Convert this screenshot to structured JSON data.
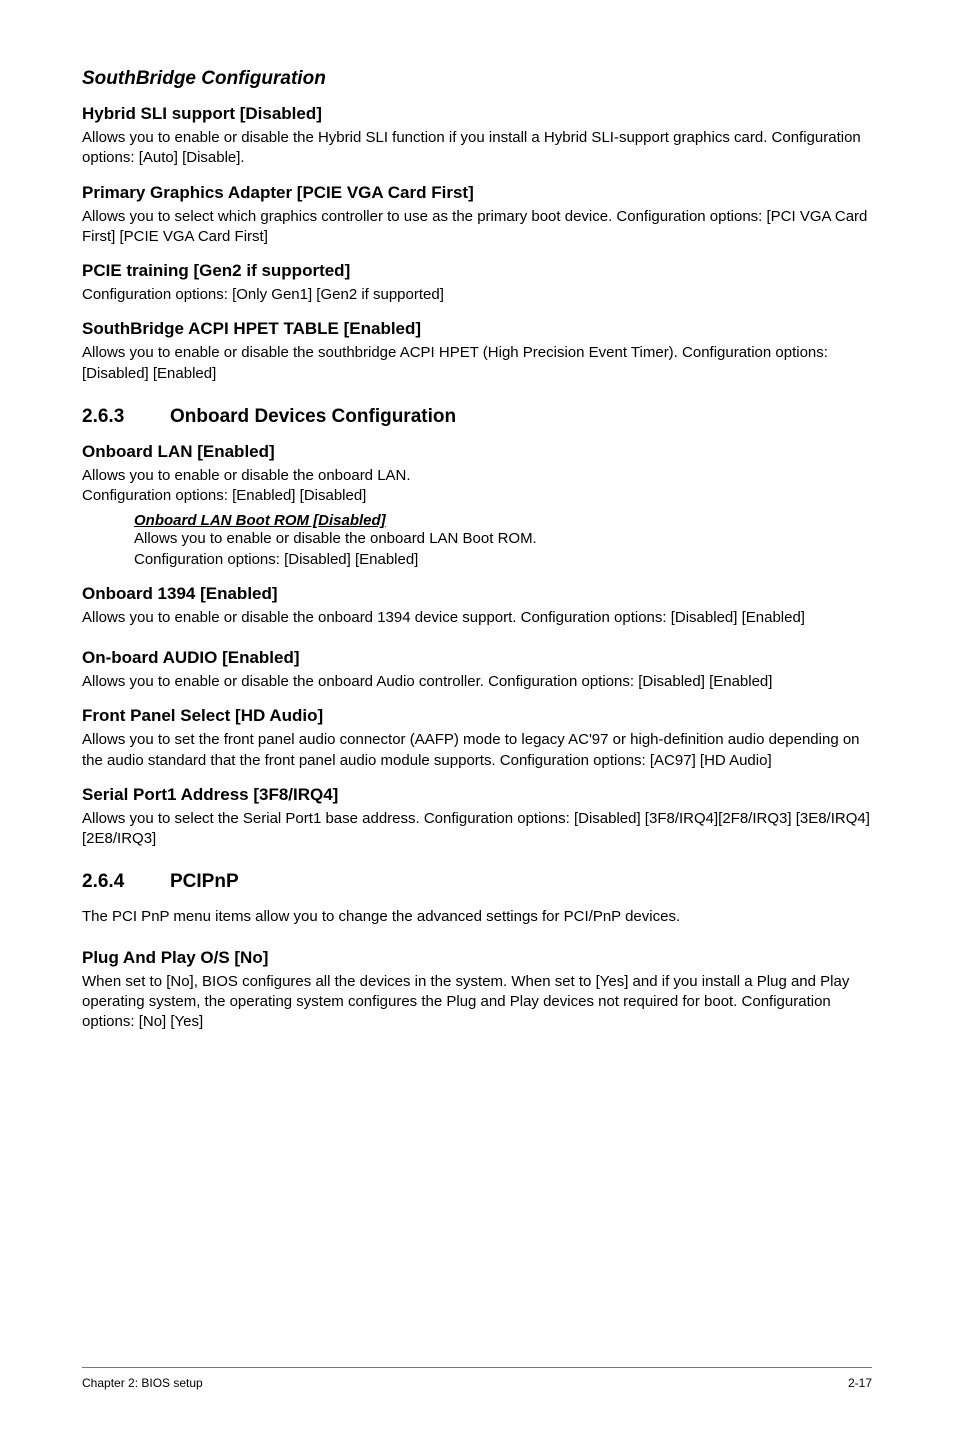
{
  "sections": {
    "southbridge": {
      "title": "SouthBridge Configuration",
      "hybrid_sli": {
        "heading": "Hybrid SLI support [Disabled]",
        "body": "Allows you to enable or disable the Hybrid SLI function if you install a Hybrid SLI-support graphics card. Configuration options: [Auto] [Disable]."
      },
      "primary_graphics": {
        "heading": "Primary Graphics Adapter [PCIE VGA Card First]",
        "body": "Allows you to select which graphics controller to use as the primary boot device. Configuration options: [PCI VGA Card First] [PCIE VGA Card First]"
      },
      "pcie_training": {
        "heading": "PCIE training [Gen2 if supported]",
        "body": "Configuration options: [Only Gen1] [Gen2 if supported]"
      },
      "acpi_hpet": {
        "heading": "SouthBridge ACPI HPET TABLE [Enabled]",
        "body": "Allows you to enable or disable the southbridge ACPI HPET (High Precision Event Timer). Configuration options: [Disabled] [Enabled]"
      }
    },
    "onboard": {
      "num": "2.6.3",
      "title": "Onboard Devices Configuration",
      "lan": {
        "heading": "Onboard LAN [Enabled]",
        "body1": "Allows you to enable or disable the onboard LAN.",
        "body2": "Configuration options: [Enabled] [Disabled]",
        "sub_heading": "Onboard LAN Boot ROM [Disabled]",
        "sub_body1": "Allows you to enable or disable the onboard LAN Boot ROM.",
        "sub_body2": "Configuration options: [Disabled] [Enabled]"
      },
      "onboard_1394": {
        "heading": "Onboard 1394 [Enabled]",
        "body": "Allows you to enable or disable the onboard 1394 device support. Configuration options: [Disabled] [Enabled]"
      },
      "audio": {
        "heading": "On-board AUDIO [Enabled]",
        "body": "Allows you to enable or disable the onboard Audio controller. Configuration options: [Disabled] [Enabled]"
      },
      "front_panel": {
        "heading": "Front Panel Select [HD Audio]",
        "body": "Allows you to set the front panel audio connector (AAFP) mode to legacy AC'97 or high-definition audio depending on the audio standard that the front panel audio module supports. Configuration options: [AC97] [HD Audio]"
      },
      "serial": {
        "heading": "Serial Port1 Address [3F8/IRQ4]",
        "body": "Allows you to select the Serial Port1 base address. Configuration options: [Disabled] [3F8/IRQ4][2F8/IRQ3] [3E8/IRQ4] [2E8/IRQ3]"
      }
    },
    "pcipnp": {
      "num": "2.6.4",
      "title": "PCIPnP",
      "intro": "The PCI PnP menu items allow you to change the advanced settings for PCI/PnP devices.",
      "plug_play": {
        "heading": "Plug And Play O/S [No]",
        "body": "When set to [No], BIOS configures all the devices in the system. When set to [Yes] and if you install a Plug and Play operating system, the operating system configures the Plug and Play devices not required for boot. Configuration options: [No] [Yes]"
      }
    }
  },
  "footer": {
    "left": "Chapter 2: BIOS setup",
    "right": "2-17"
  }
}
